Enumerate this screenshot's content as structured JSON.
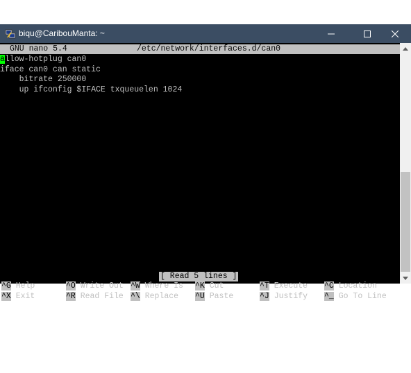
{
  "window": {
    "title": "biqu@CaribouManta: ~"
  },
  "nano": {
    "version": "GNU nano 5.4",
    "file_path": "/etc/network/interfaces.d/can0"
  },
  "file_lines": [
    "allow-hotplug can0",
    "iface can0 can static",
    "    bitrate 250000",
    "    up ifconfig $IFACE txqueuelen 1024"
  ],
  "cursor_char": "a",
  "file_first_line_rest": "llow-hotplug can0",
  "status_message": "[ Read 5 lines ]",
  "shortcuts_row1": [
    {
      "key": "^G",
      "label": "Help"
    },
    {
      "key": "^O",
      "label": "Write Out"
    },
    {
      "key": "^W",
      "label": "Where Is"
    },
    {
      "key": "^K",
      "label": "Cut"
    },
    {
      "key": "^T",
      "label": "Execute"
    },
    {
      "key": "^C",
      "label": "Location"
    }
  ],
  "shortcuts_row2": [
    {
      "key": "^X",
      "label": "Exit"
    },
    {
      "key": "^R",
      "label": "Read File"
    },
    {
      "key": "^\\",
      "label": "Replace"
    },
    {
      "key": "^U",
      "label": "Paste"
    },
    {
      "key": "^J",
      "label": "Justify"
    },
    {
      "key": "^_",
      "label": "Go To Line"
    }
  ],
  "colors": {
    "titlebar": "#3b4d63",
    "terminal_bg": "#000000",
    "terminal_fg": "#c0c0c0",
    "cursor": "#00ff00"
  },
  "icons": {
    "app": "putty-icon",
    "minimize": "minimize-icon",
    "maximize": "maximize-icon",
    "close": "close-icon"
  }
}
